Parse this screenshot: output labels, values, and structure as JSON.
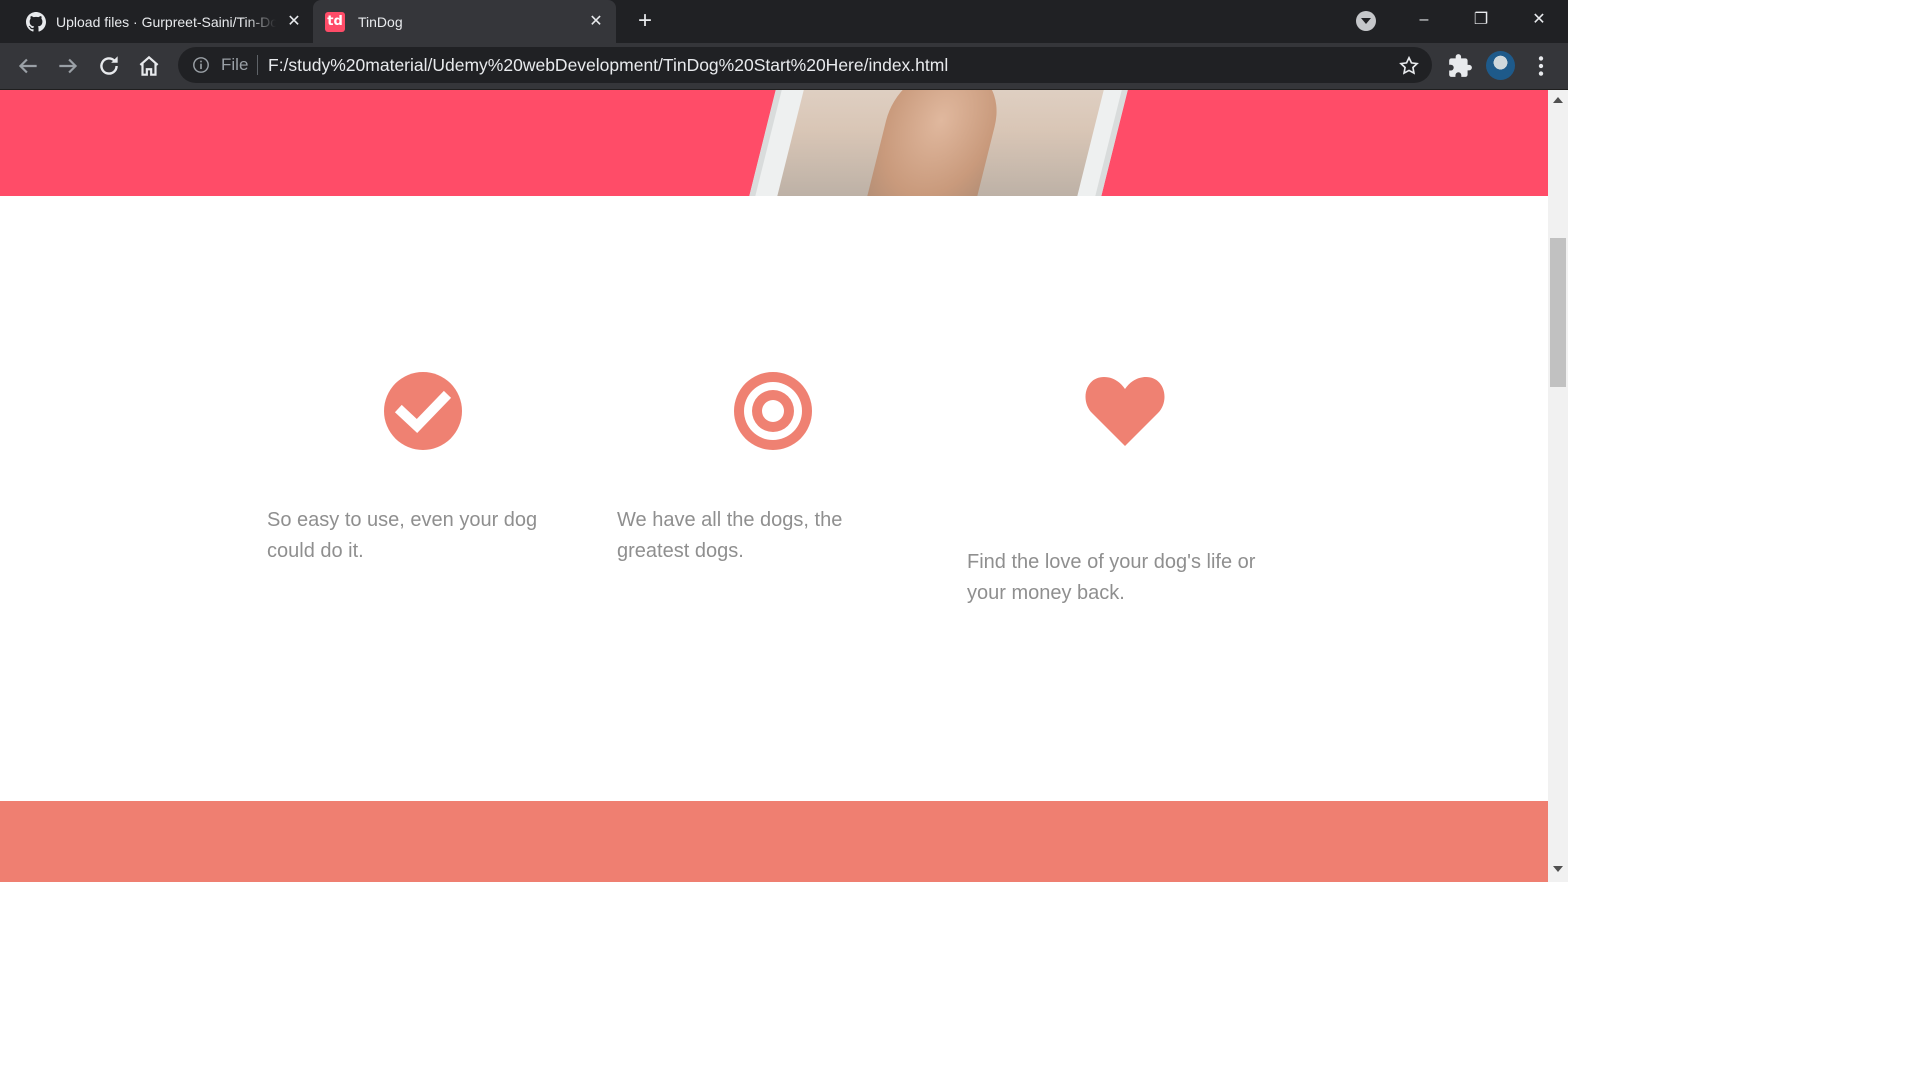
{
  "browser": {
    "tabs": [
      {
        "title": "Upload files · Gurpreet-Saini/Tin-Dog",
        "icon": "github-icon",
        "active": false
      },
      {
        "title": "TinDog",
        "icon": "tindog-favicon",
        "favicon_text": "td",
        "active": true
      }
    ],
    "omnibox": {
      "scheme_label": "File",
      "url": "F:/study%20material/Udemy%20webDevelopment/TinDog%20Start%20Here/index.html"
    }
  },
  "page": {
    "colors": {
      "hero": "#ff4c68",
      "icon": "#ef8172",
      "feature_text": "#8f8f8f",
      "cta": "#ef7f71"
    },
    "features": [
      {
        "icon": "check-circle-icon",
        "text": "So easy to use, even your dog could do it."
      },
      {
        "icon": "bullseye-icon",
        "text": "We have all the dogs, the greatest dogs."
      },
      {
        "icon": "heart-icon",
        "text": "Find the love of your dog's life or your money back."
      }
    ]
  }
}
